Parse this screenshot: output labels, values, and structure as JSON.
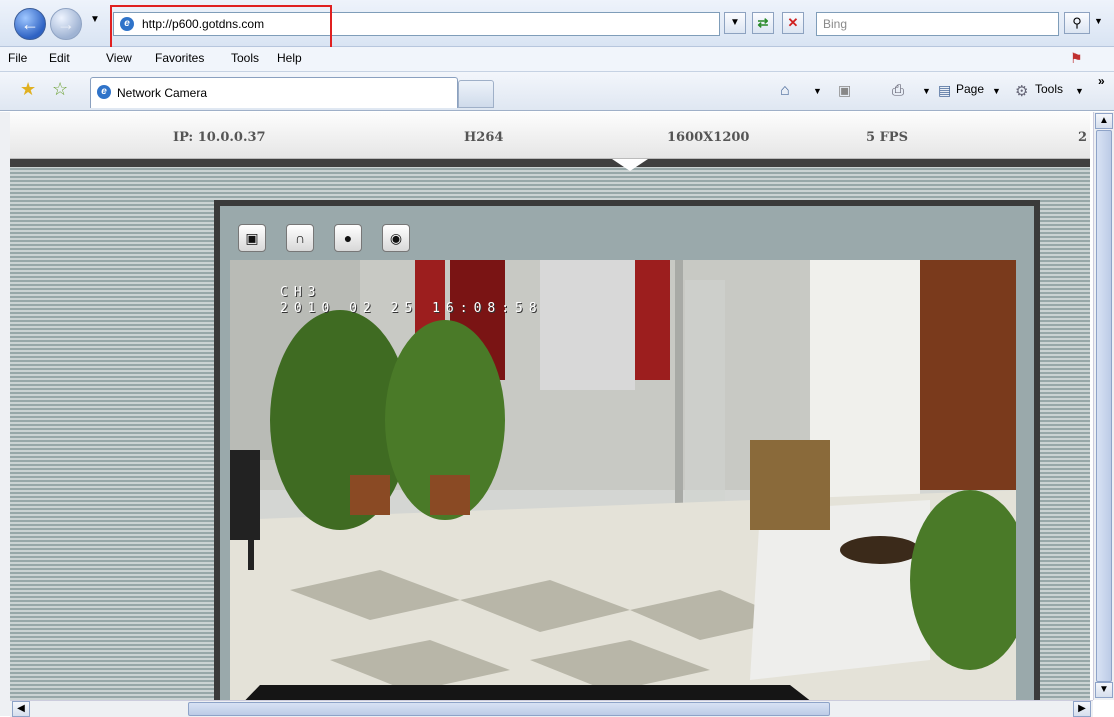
{
  "browser": {
    "url": "http://p600.gotdns.com",
    "search_placeholder": "Bing",
    "menu": [
      "File",
      "Edit",
      "View",
      "Favorites",
      "Tools",
      "Help"
    ],
    "tab_title": "Network Camera",
    "commands": {
      "page": "Page",
      "tools": "Tools"
    }
  },
  "camera": {
    "info": {
      "ip": "IP: 10.0.0.37",
      "codec": "H264",
      "resolution": "1600X1200",
      "fps": "5 FPS",
      "extra": "2"
    },
    "osd": {
      "channel": "CH3",
      "timestamp": "2010 02 25 16:08:58"
    },
    "controls": [
      "fullscreen-icon",
      "audio-icon",
      "record-icon",
      "snapshot-icon"
    ]
  },
  "colors": {
    "highlight_box": "#e02020",
    "ie_blue": "#2e62c3"
  }
}
